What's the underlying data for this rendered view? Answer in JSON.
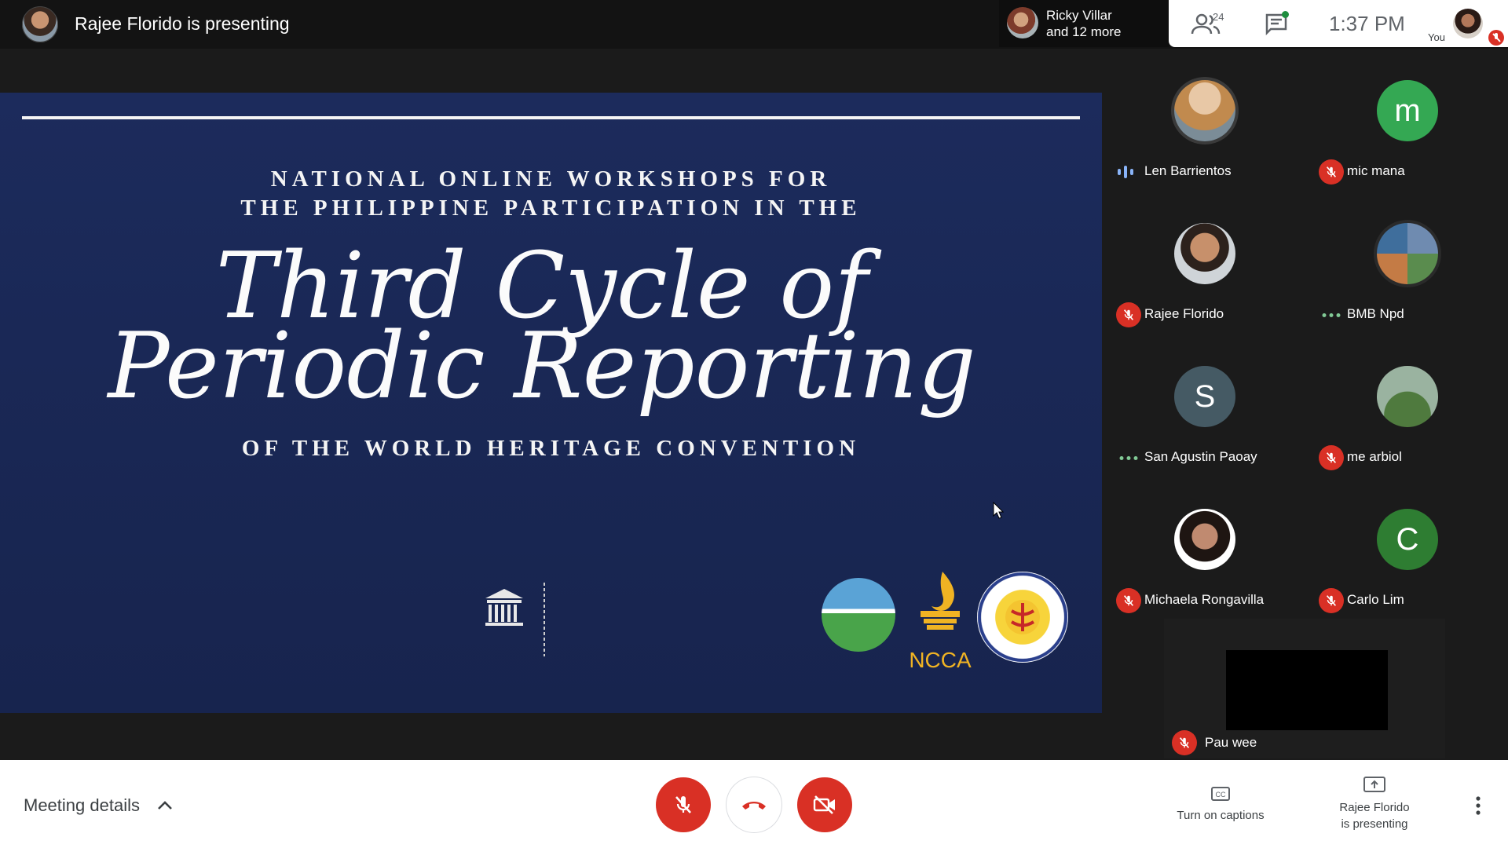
{
  "header": {
    "presenting_text": "Rajee Florido is presenting",
    "others_name": "Ricky Villar",
    "others_more": "and 12 more",
    "people_count": "24",
    "time": "1:37 PM",
    "you_label": "You"
  },
  "slide": {
    "line1": "NATIONAL ONLINE WORKSHOPS FOR",
    "line2": "THE PHILIPPINE PARTICIPATION IN THE",
    "title1": "Third Cycle of",
    "title2": "Periodic Reporting",
    "line3": "OF THE WORLD HERITAGE CONVENTION",
    "ncca": "NCCA"
  },
  "participants": [
    {
      "name": "Len Barrientos",
      "status": "speaking",
      "avatar": "photo",
      "color": "#c9a98a"
    },
    {
      "name": "mic mana",
      "status": "muted",
      "avatar": "m",
      "color": "#34a853"
    },
    {
      "name": "Rajee Florido",
      "status": "muted",
      "avatar": "photo",
      "color": "#b58768"
    },
    {
      "name": "BMB Npd",
      "status": "dots",
      "avatar": "photo",
      "color": "#6f8bb0"
    },
    {
      "name": "San Agustin Paoay",
      "status": "dots",
      "avatar": "S",
      "color": "#455a64"
    },
    {
      "name": "me arbiol",
      "status": "muted",
      "avatar": "photo",
      "color": "#7f9f76"
    },
    {
      "name": "Michaela Rongavilla",
      "status": "muted",
      "avatar": "photo",
      "color": "#a87a64"
    },
    {
      "name": "Carlo Lim",
      "status": "muted",
      "avatar": "C",
      "color": "#2e7d32"
    }
  ],
  "pau": {
    "name": "Pau wee"
  },
  "footer": {
    "meeting_details": "Meeting details",
    "captions": "Turn on captions",
    "presenting_line1": "Rajee Florido",
    "presenting_line2": "is presenting"
  },
  "colors": {
    "danger": "#d93025",
    "accent_green": "#34a853",
    "speaking": "#8ab4f8"
  }
}
